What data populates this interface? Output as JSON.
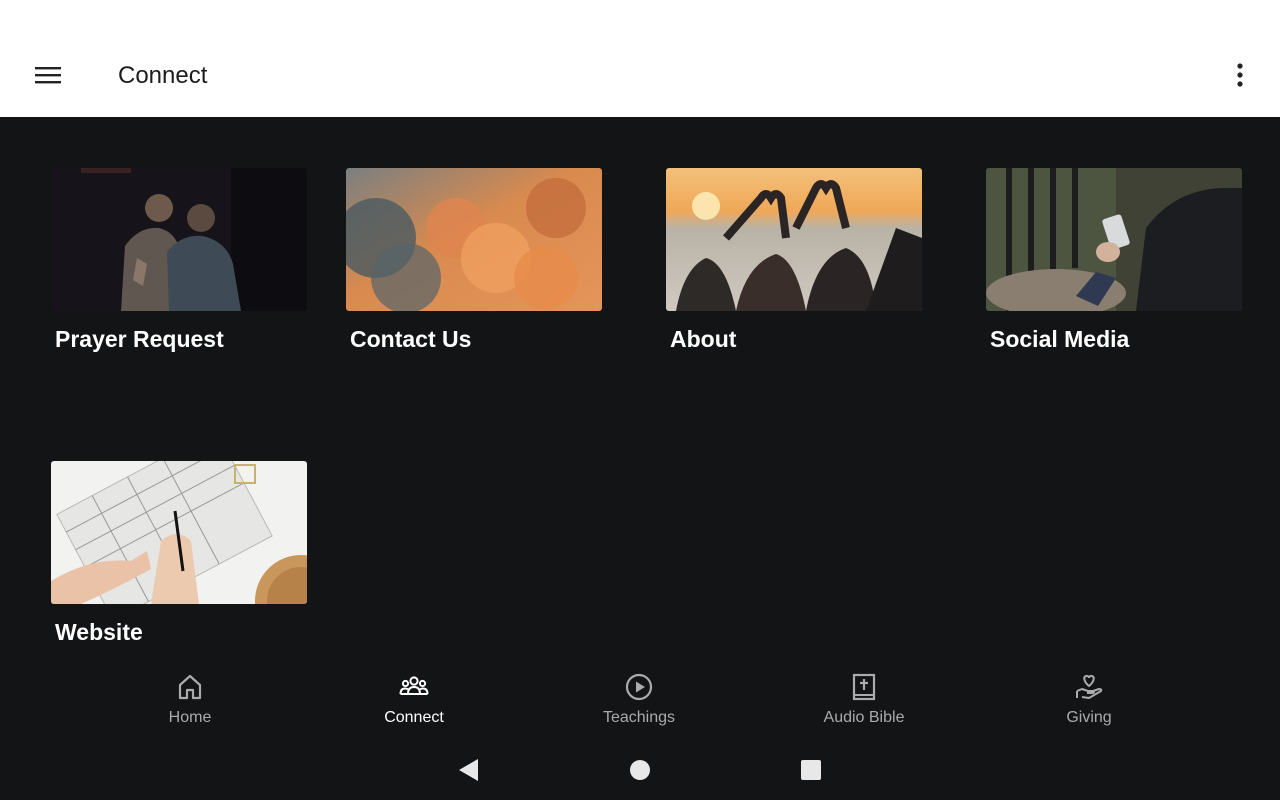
{
  "app_bar": {
    "title": "Connect",
    "menu_icon": "hamburger-menu-icon",
    "overflow_icon": "more-vertical-icon",
    "background": "#ffffff"
  },
  "tiles": [
    {
      "label": "Prayer Request",
      "image": "two men praying together"
    },
    {
      "label": "Contact Us",
      "image": "orange sunset clouds"
    },
    {
      "label": "About",
      "image": "friends making heart shapes at sunset lake"
    },
    {
      "label": "Social Media",
      "image": "person holding smartphone"
    },
    {
      "label": "Website",
      "image": "hands writing in notebook"
    }
  ],
  "bottom_nav": {
    "items": [
      {
        "label": "Home",
        "icon": "home-icon",
        "active": false
      },
      {
        "label": "Connect",
        "icon": "group-icon",
        "active": true
      },
      {
        "label": "Teachings",
        "icon": "play-circle-icon",
        "active": false
      },
      {
        "label": "Audio Bible",
        "icon": "bible-icon",
        "active": false
      },
      {
        "label": "Giving",
        "icon": "giving-hand-heart-icon",
        "active": false
      }
    ]
  },
  "system_nav": [
    "back-icon",
    "home-circle-icon",
    "recents-square-icon"
  ],
  "colors": {
    "background": "#131416",
    "active_nav": "#ffffff",
    "inactive_nav": "#a9abad"
  }
}
